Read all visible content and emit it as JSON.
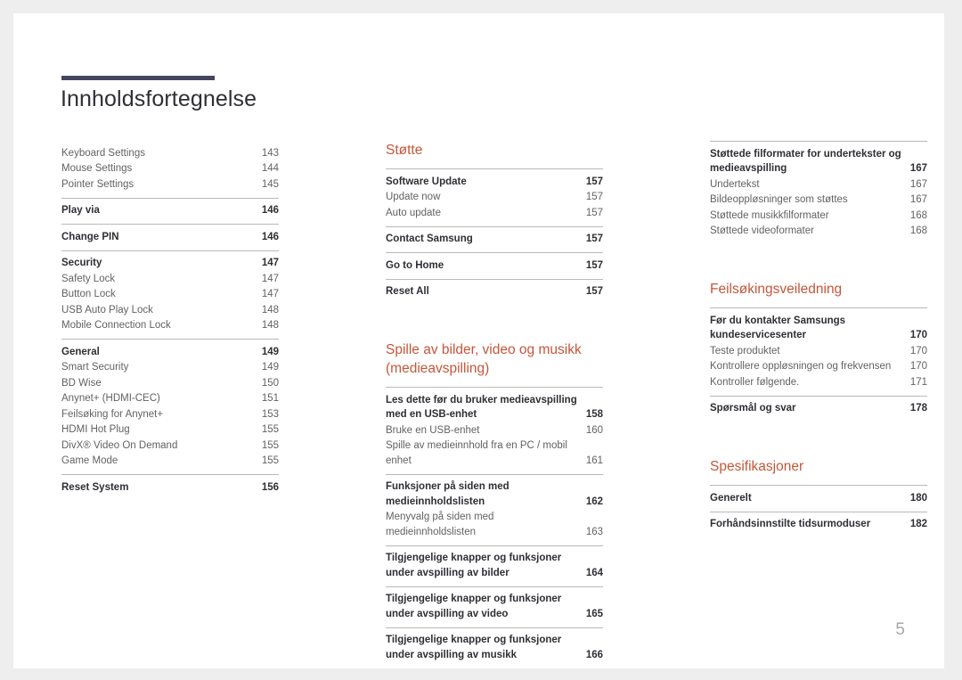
{
  "document": {
    "title": "Innholdsfortegnelse",
    "page_number": "5",
    "accent_color": "#c4573b",
    "rule_color": "#454560"
  },
  "columns": [
    {
      "name": "column-1",
      "blocks": [
        {
          "type": "group",
          "rule": false,
          "entries": [
            {
              "level": 2,
              "label": "Keyboard Settings",
              "page": "143"
            },
            {
              "level": 2,
              "label": "Mouse Settings",
              "page": "144"
            },
            {
              "level": 2,
              "label": "Pointer Settings",
              "page": "145"
            }
          ]
        },
        {
          "type": "group",
          "rule": true,
          "entries": [
            {
              "level": 1,
              "label": "Play via",
              "page": "146"
            }
          ]
        },
        {
          "type": "group",
          "rule": true,
          "entries": [
            {
              "level": 1,
              "label": "Change PIN",
              "page": "146"
            }
          ]
        },
        {
          "type": "group",
          "rule": true,
          "entries": [
            {
              "level": 1,
              "label": "Security",
              "page": "147"
            },
            {
              "level": 2,
              "label": "Safety Lock",
              "page": "147"
            },
            {
              "level": 2,
              "label": "Button Lock",
              "page": "147"
            },
            {
              "level": 2,
              "label": "USB Auto Play Lock",
              "page": "148"
            },
            {
              "level": 2,
              "label": "Mobile Connection Lock",
              "page": "148"
            }
          ]
        },
        {
          "type": "group",
          "rule": true,
          "entries": [
            {
              "level": 1,
              "label": "General",
              "page": "149"
            },
            {
              "level": 2,
              "label": "Smart Security",
              "page": "149"
            },
            {
              "level": 2,
              "label": "BD Wise",
              "page": "150"
            },
            {
              "level": 2,
              "label": "Anynet+ (HDMI-CEC)",
              "page": "151"
            },
            {
              "level": 2,
              "label": "Feilsøking for Anynet+",
              "page": "153"
            },
            {
              "level": 2,
              "label": "HDMI Hot Plug",
              "page": "155"
            },
            {
              "level": 2,
              "label": "DivX® Video On Demand",
              "page": "155"
            },
            {
              "level": 2,
              "label": "Game Mode",
              "page": "155"
            }
          ]
        },
        {
          "type": "group",
          "rule": true,
          "entries": [
            {
              "level": 1,
              "label": "Reset System",
              "page": "156"
            }
          ]
        }
      ]
    },
    {
      "name": "column-2",
      "blocks": [
        {
          "type": "heading",
          "label": "Støtte",
          "spacer": "none"
        },
        {
          "type": "group",
          "rule": true,
          "entries": [
            {
              "level": 1,
              "label": "Software Update",
              "page": "157"
            },
            {
              "level": 2,
              "label": "Update now",
              "page": "157"
            },
            {
              "level": 2,
              "label": "Auto update",
              "page": "157"
            }
          ]
        },
        {
          "type": "group",
          "rule": true,
          "entries": [
            {
              "level": 1,
              "label": "Contact Samsung",
              "page": "157"
            }
          ]
        },
        {
          "type": "group",
          "rule": true,
          "entries": [
            {
              "level": 1,
              "label": "Go to Home",
              "page": "157"
            }
          ]
        },
        {
          "type": "group",
          "rule": true,
          "entries": [
            {
              "level": 1,
              "label": "Reset All",
              "page": "157"
            }
          ]
        },
        {
          "type": "heading",
          "label": "Spille av bilder, video og musikk (medieavspilling)",
          "spacer": "large"
        },
        {
          "type": "group",
          "rule": true,
          "entries": [
            {
              "level": 1,
              "label": "Les dette før du bruker medieavspilling med en USB-enhet",
              "page": "158"
            },
            {
              "level": 2,
              "label": "Bruke en USB-enhet",
              "page": "160"
            },
            {
              "level": 2,
              "label": "Spille av medieinnhold fra en PC / mobil enhet",
              "page": "161"
            }
          ]
        },
        {
          "type": "group",
          "rule": true,
          "entries": [
            {
              "level": 1,
              "label": "Funksjoner på siden med medieinnholdslisten",
              "page": "162"
            },
            {
              "level": 2,
              "label": "Menyvalg på siden med medieinnholdslisten",
              "page": "163"
            }
          ]
        },
        {
          "type": "group",
          "rule": true,
          "entries": [
            {
              "level": 1,
              "label": "Tilgjengelige knapper og funksjoner under avspilling av bilder",
              "page": "164"
            }
          ]
        },
        {
          "type": "group",
          "rule": true,
          "entries": [
            {
              "level": 1,
              "label": "Tilgjengelige knapper og funksjoner under avspilling av video",
              "page": "165"
            }
          ]
        },
        {
          "type": "group",
          "rule": true,
          "entries": [
            {
              "level": 1,
              "label": "Tilgjengelige knapper og funksjoner under avspilling av musikk",
              "page": "166"
            }
          ]
        }
      ]
    },
    {
      "name": "column-3",
      "blocks": [
        {
          "type": "group",
          "rule": true,
          "entries": [
            {
              "level": 1,
              "label": "Støttede filformater for undertekster og medieavspilling",
              "page": "167"
            },
            {
              "level": 2,
              "label": "Undertekst",
              "page": "167"
            },
            {
              "level": 2,
              "label": "Bildeoppløsninger som støttes",
              "page": "167"
            },
            {
              "level": 2,
              "label": "Støttede musikkfilformater",
              "page": "168"
            },
            {
              "level": 2,
              "label": "Støttede videoformater",
              "page": "168"
            }
          ]
        },
        {
          "type": "heading",
          "label": "Feilsøkingsveiledning",
          "spacer": "large"
        },
        {
          "type": "group",
          "rule": true,
          "entries": [
            {
              "level": 1,
              "label": "Før du kontakter Samsungs kundeservicesenter",
              "page": "170"
            },
            {
              "level": 2,
              "label": "Teste produktet",
              "page": "170"
            },
            {
              "level": 2,
              "label": "Kontrollere oppløsningen og frekvensen",
              "page": "170"
            },
            {
              "level": 2,
              "label": "Kontroller følgende.",
              "page": "171"
            }
          ]
        },
        {
          "type": "group",
          "rule": true,
          "entries": [
            {
              "level": 1,
              "label": "Spørsmål og svar",
              "page": "178"
            }
          ]
        },
        {
          "type": "heading",
          "label": "Spesifikasjoner",
          "spacer": "large"
        },
        {
          "type": "group",
          "rule": true,
          "entries": [
            {
              "level": 1,
              "label": "Generelt",
              "page": "180"
            }
          ]
        },
        {
          "type": "group",
          "rule": true,
          "entries": [
            {
              "level": 1,
              "label": "Forhåndsinnstilte tidsurmoduser",
              "page": "182"
            }
          ]
        }
      ]
    }
  ]
}
